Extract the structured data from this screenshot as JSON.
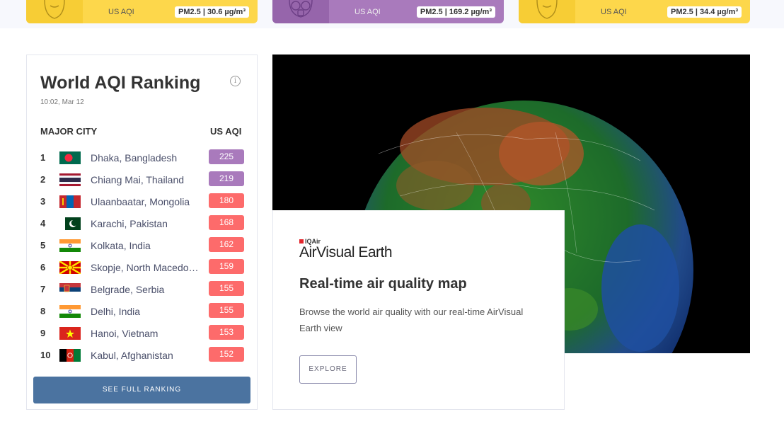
{
  "top_cards": [
    {
      "label": "US AQI",
      "pm": "PM2.5 | 30.6 µg/m³",
      "color": "#fdd74b"
    },
    {
      "label": "US AQI",
      "pm": "PM2.5 | 169.2 µg/m³",
      "color": "#a97abc"
    },
    {
      "label": "US AQI",
      "pm": "PM2.5 | 34.4 µg/m³",
      "color": "#fdd74b"
    }
  ],
  "ranking": {
    "title": "World AQI Ranking",
    "time": "10:02, Mar 12",
    "col_city": "MAJOR CITY",
    "col_aqi": "US AQI",
    "rows": [
      {
        "rank": "1",
        "city": "Dhaka, Bangladesh",
        "aqi": "225",
        "level": "very-unhealthy",
        "flag": "bangladesh-flag-icon"
      },
      {
        "rank": "2",
        "city": "Chiang Mai, Thailand",
        "aqi": "219",
        "level": "very-unhealthy",
        "flag": "thailand-flag-icon"
      },
      {
        "rank": "3",
        "city": "Ulaanbaatar, Mongolia",
        "aqi": "180",
        "level": "unhealthy",
        "flag": "mongolia-flag-icon"
      },
      {
        "rank": "4",
        "city": "Karachi, Pakistan",
        "aqi": "168",
        "level": "unhealthy",
        "flag": "pakistan-flag-icon"
      },
      {
        "rank": "5",
        "city": "Kolkata, India",
        "aqi": "162",
        "level": "unhealthy",
        "flag": "india-flag-icon"
      },
      {
        "rank": "6",
        "city": "Skopje, North Macedonia",
        "aqi": "159",
        "level": "unhealthy",
        "flag": "north-macedonia-flag-icon"
      },
      {
        "rank": "7",
        "city": "Belgrade, Serbia",
        "aqi": "155",
        "level": "unhealthy",
        "flag": "serbia-flag-icon"
      },
      {
        "rank": "8",
        "city": "Delhi, India",
        "aqi": "155",
        "level": "unhealthy",
        "flag": "india-flag-icon"
      },
      {
        "rank": "9",
        "city": "Hanoi, Vietnam",
        "aqi": "153",
        "level": "unhealthy",
        "flag": "vietnam-flag-icon"
      },
      {
        "rank": "10",
        "city": "Kabul, Afghanistan",
        "aqi": "152",
        "level": "unhealthy",
        "flag": "afghanistan-flag-icon"
      }
    ],
    "button": "SEE FULL RANKING"
  },
  "level_colors": {
    "very-unhealthy": "#a97abc",
    "unhealthy": "#fd6b6b"
  },
  "earth_card": {
    "brand_small": "IQAir",
    "brand_big": "AirVisual Earth",
    "title": "Real-time air quality map",
    "description": "Browse the world air quality with our real-time AirVisual Earth view",
    "button": "EXPLORE"
  }
}
